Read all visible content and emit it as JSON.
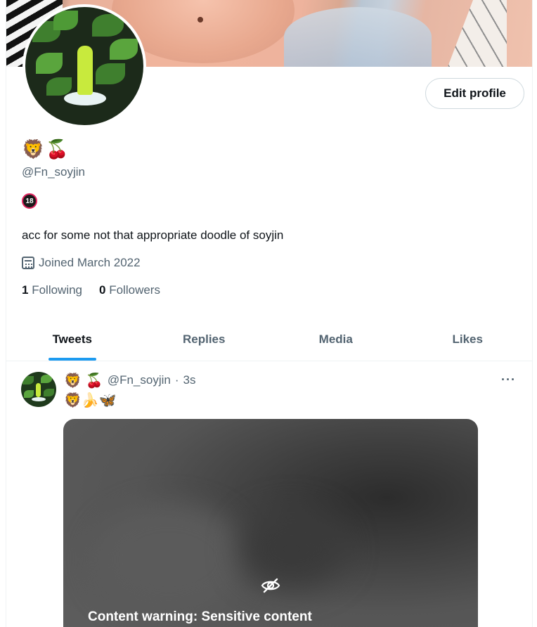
{
  "profile": {
    "display_name_emojis": [
      "🦁",
      "🍒"
    ],
    "handle": "@Fn_soyjin",
    "badge": "18",
    "bio": "acc for some not that appropriate doodle of soyjin",
    "joined": "Joined March 2022",
    "following_count": "1",
    "following_label": "Following",
    "followers_count": "0",
    "followers_label": "Followers",
    "edit_button_label": "Edit profile"
  },
  "tabs": [
    {
      "label": "Tweets",
      "active": true
    },
    {
      "label": "Replies",
      "active": false
    },
    {
      "label": "Media",
      "active": false
    },
    {
      "label": "Likes",
      "active": false
    }
  ],
  "tweet": {
    "author_emojis": [
      "🦁",
      "🍒"
    ],
    "handle": "@Fn_soyjin",
    "separator": "·",
    "time": "3s",
    "text": "🦁🍌🦋",
    "more_label": "···",
    "media": {
      "content_warning": "Content warning: Sensitive content",
      "icon": "eye-off-icon"
    }
  },
  "colors": {
    "accent": "#1d9bf0",
    "secondary_text": "#536471",
    "primary_text": "#0f1419",
    "border": "#eff3f4"
  }
}
